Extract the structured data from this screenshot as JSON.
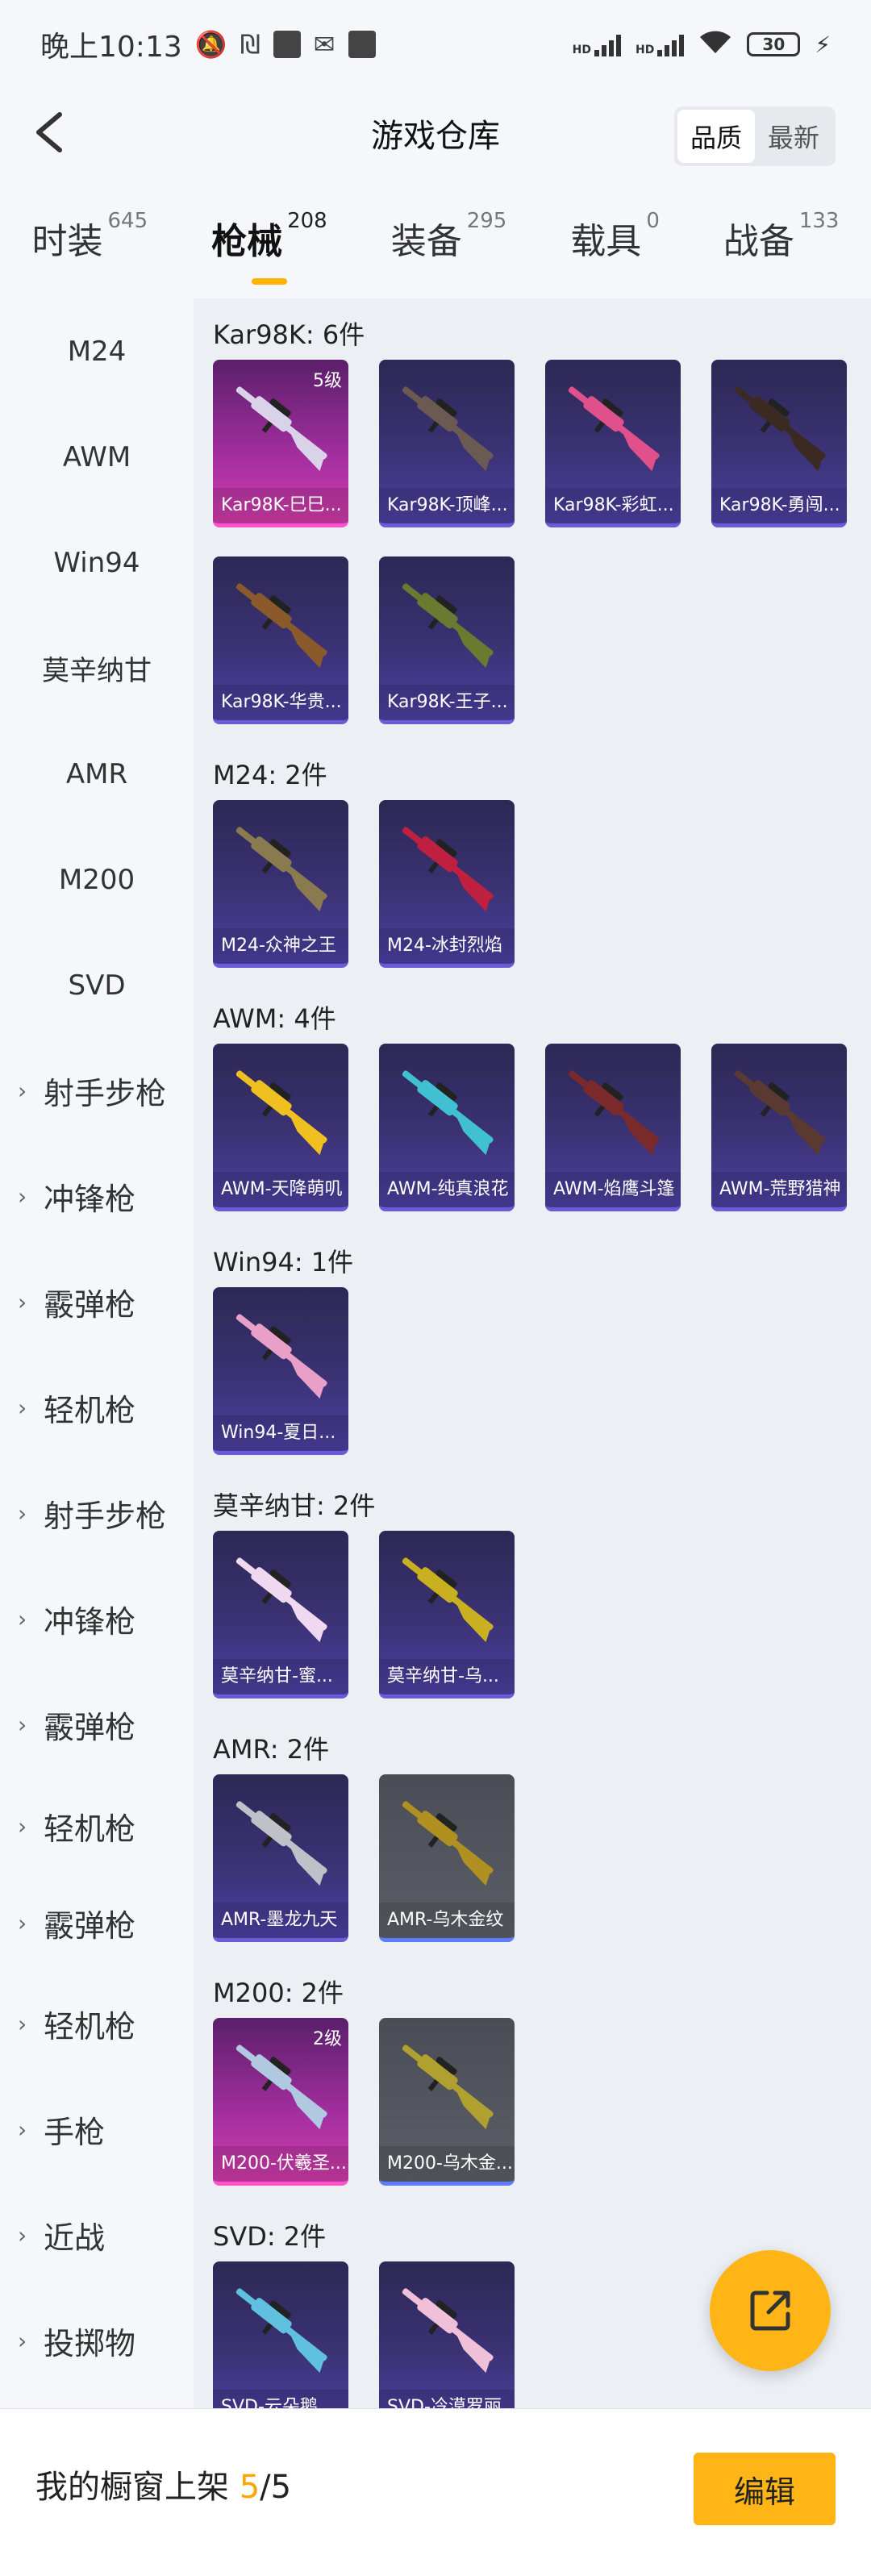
{
  "status_bar": {
    "time": "晚上10:13",
    "hd1": "HD",
    "hd2": "HD",
    "battery": "30"
  },
  "header": {
    "title": "游戏仓库",
    "sort_quality": "品质",
    "sort_latest": "最新"
  },
  "tabs": [
    {
      "label": "时装",
      "count": "645"
    },
    {
      "label": "枪械",
      "count": "208"
    },
    {
      "label": "装备",
      "count": "295"
    },
    {
      "label": "载具",
      "count": "0"
    },
    {
      "label": "战备",
      "count": "133"
    }
  ],
  "sidebar": {
    "weapons": [
      "M24",
      "AWM",
      "Win94",
      "莫辛纳甘",
      "AMR",
      "M200",
      "SVD"
    ],
    "groups": [
      "射手步枪",
      "冲锋枪",
      "霰弹枪",
      "轻机枪",
      "射手步枪",
      "冲锋枪",
      "霰弹枪",
      "轻机枪",
      "霰弹枪",
      "轻机枪",
      "手枪",
      "近战",
      "投掷物"
    ]
  },
  "sections": [
    {
      "title": "Kar98K: 6件",
      "items": [
        {
          "name": "Kar98K-巳巳...",
          "level": "5级",
          "rarity": "pink",
          "gun_color": "#d9d2e8"
        },
        {
          "name": "Kar98K-顶峰...",
          "level": "",
          "rarity": "purple",
          "gun_color": "#6b5a52"
        },
        {
          "name": "Kar98K-彩虹...",
          "level": "",
          "rarity": "purple",
          "gun_color": "#e0508a"
        },
        {
          "name": "Kar98K-勇闯...",
          "level": "",
          "rarity": "purple",
          "gun_color": "#3a2a22"
        },
        {
          "name": "Kar98K-华贵...",
          "level": "",
          "rarity": "purple",
          "gun_color": "#8a5a2a"
        },
        {
          "name": "Kar98K-王子...",
          "level": "",
          "rarity": "purple",
          "gun_color": "#6a7a30"
        }
      ]
    },
    {
      "title": "M24: 2件",
      "items": [
        {
          "name": "M24-众神之王",
          "level": "",
          "rarity": "purple",
          "gun_color": "#8a7a50"
        },
        {
          "name": "M24-冰封烈焰",
          "level": "",
          "rarity": "purple",
          "gun_color": "#c02040"
        }
      ]
    },
    {
      "title": "AWM: 4件",
      "items": [
        {
          "name": "AWM-天降萌叽",
          "level": "",
          "rarity": "purple",
          "gun_color": "#f0c020"
        },
        {
          "name": "AWM-纯真浪花",
          "level": "",
          "rarity": "purple",
          "gun_color": "#40c0d0"
        },
        {
          "name": "AWM-焰鹰斗篷",
          "level": "",
          "rarity": "purple",
          "gun_color": "#7a2a2a"
        },
        {
          "name": "AWM-荒野猎神",
          "level": "",
          "rarity": "purple",
          "gun_color": "#5a3a30"
        }
      ]
    },
    {
      "title": "Win94: 1件",
      "items": [
        {
          "name": "Win94-夏日...",
          "level": "",
          "rarity": "purple",
          "gun_color": "#e8a0c8"
        }
      ]
    },
    {
      "title": "莫辛纳甘: 2件",
      "items": [
        {
          "name": "莫辛纳甘-蜜...",
          "level": "",
          "rarity": "purple",
          "gun_color": "#f0d8f0"
        },
        {
          "name": "莫辛纳甘-乌...",
          "level": "",
          "rarity": "purple",
          "gun_color": "#c8b020"
        }
      ]
    },
    {
      "title": "AMR: 2件",
      "items": [
        {
          "name": "AMR-墨龙九天",
          "level": "",
          "rarity": "purple",
          "gun_color": "#c0c0c8"
        },
        {
          "name": "AMR-乌木金纹",
          "level": "",
          "rarity": "gray",
          "gun_color": "#b09020"
        }
      ]
    },
    {
      "title": "M200: 2件",
      "items": [
        {
          "name": "M200-伏羲圣...",
          "level": "2级",
          "rarity": "pink",
          "gun_color": "#b0c8e0"
        },
        {
          "name": "M200-乌木金...",
          "level": "",
          "rarity": "gray",
          "gun_color": "#b0a030"
        }
      ]
    },
    {
      "title": "SVD: 2件",
      "items": [
        {
          "name": "SVD-云朵鹅",
          "level": "",
          "rarity": "purple",
          "gun_color": "#60c0e0"
        },
        {
          "name": "SVD-冷漠罗丽",
          "level": "",
          "rarity": "purple",
          "gun_color": "#f0c0d8"
        }
      ]
    }
  ],
  "bottom_bar": {
    "label": "我的橱窗上架",
    "current": "5",
    "total": "/5",
    "edit_label": "编辑"
  },
  "colors": {
    "accent": "#ffb515",
    "underline": "#ffb400"
  }
}
